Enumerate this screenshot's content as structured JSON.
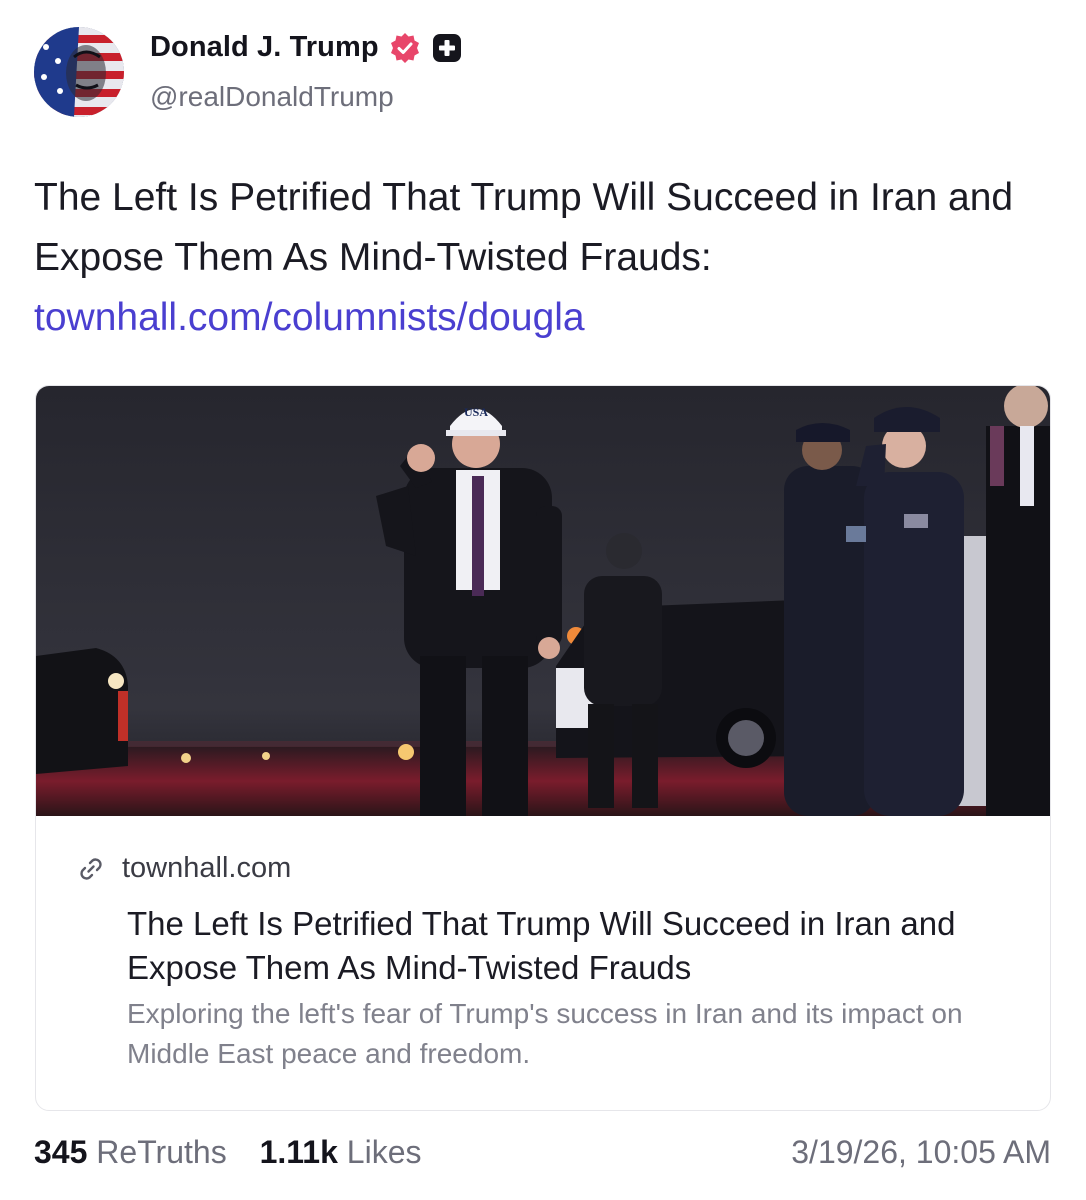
{
  "author": {
    "display_name": "Donald J. Trump",
    "handle": "@realDonaldTrump",
    "verified_color": "#e8466a",
    "badge_icon": "plus-badge-icon"
  },
  "post": {
    "text": "The Left Is Petrified That Trump Will Succeed in Iran and Expose Them As Mind-Twisted Frauds:",
    "link_text": "townhall.com/columnists/dougla",
    "link_color": "#4a3fd0"
  },
  "link_card": {
    "image": "night-tarmac-photo",
    "image_cap_text": "USA",
    "domain": "townhall.com",
    "title": "The Left Is Petrified That Trump Will Succeed in Iran and Expose Them As Mind-Twisted Frauds",
    "description": "Exploring the left's fear of Trump's success in Iran and its impact on Middle East peace and freedom."
  },
  "stats": {
    "retruths_count": "345",
    "retruths_label": "ReTruths",
    "likes_count": "1.11k",
    "likes_label": "Likes",
    "timestamp": "3/19/26, 10:05 AM"
  }
}
